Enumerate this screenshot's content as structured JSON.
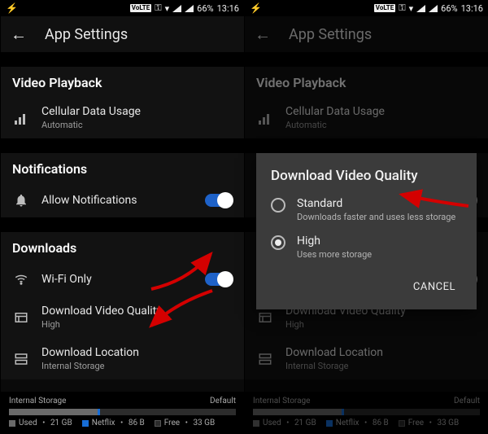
{
  "statusbar": {
    "battery_pct": "66%",
    "time": "13:16",
    "volte": "VoLTE"
  },
  "header": {
    "title": "App Settings"
  },
  "sections": {
    "video": {
      "title": "Video Playback",
      "cellular": {
        "label": "Cellular Data Usage",
        "value": "Automatic"
      }
    },
    "notifications": {
      "title": "Notifications",
      "allow": {
        "label": "Allow Notifications"
      }
    },
    "downloads": {
      "title": "Downloads",
      "wifi": {
        "label": "Wi-Fi Only"
      },
      "quality": {
        "label": "Download Video Quality",
        "value": "High"
      },
      "location": {
        "label": "Download Location",
        "value": "Internal Storage"
      }
    }
  },
  "storage": {
    "title": "Internal Storage",
    "default_label": "Default",
    "used_label": "Used",
    "used_value": "21 GB",
    "netflix_label": "Netflix",
    "netflix_value": "86 B",
    "free_label": "Free",
    "free_value": "33 GB",
    "used_pct": 39,
    "netflix_pct": 1,
    "free_pct": 60
  },
  "dialog": {
    "title": "Download Video Quality",
    "option_standard": {
      "label": "Standard",
      "sub": "Downloads faster and uses less storage"
    },
    "option_high": {
      "label": "High",
      "sub": "Uses more storage"
    },
    "selected": "high",
    "cancel": "CANCEL"
  },
  "colors": {
    "accent": "#1e62c9",
    "arrow": "#d40000"
  }
}
